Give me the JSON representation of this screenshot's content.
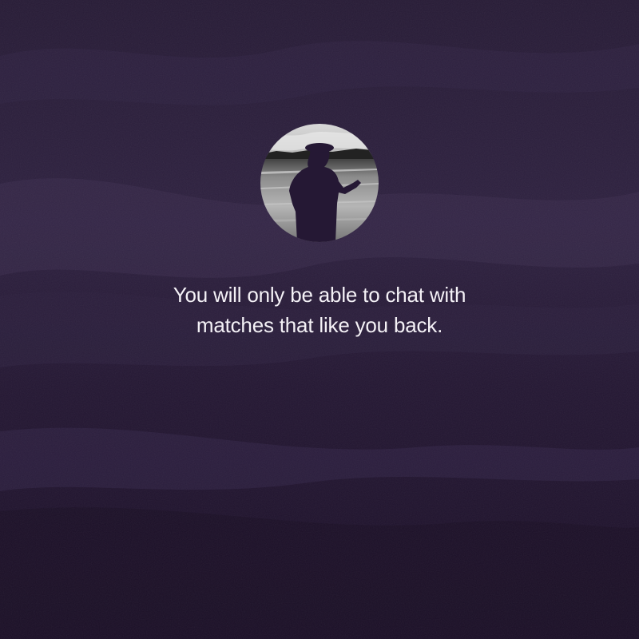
{
  "background": {
    "base_color": "#241832",
    "style": "dark purple painted canvas"
  },
  "avatar": {
    "icon": "profile-photo-silhouette-guitarist-at-sea"
  },
  "message": {
    "line1": "You will only be able to chat with",
    "line2": "matches that like you back."
  },
  "colors": {
    "text": "#f4f1f6",
    "overlay": "#241832"
  }
}
